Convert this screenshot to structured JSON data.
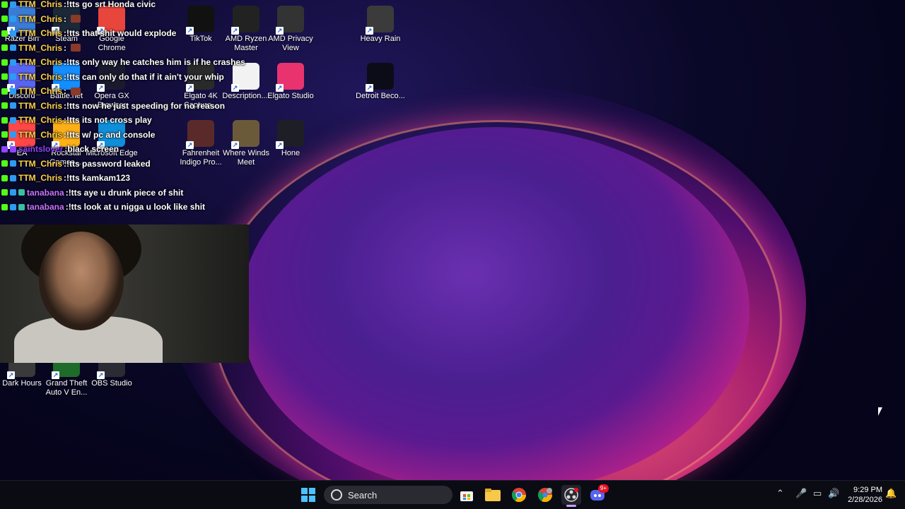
{
  "desktop_icons": [
    {
      "id": "razer",
      "label": "Razer Bin",
      "color": "#3a7bd5"
    },
    {
      "id": "steam",
      "label": "Steam",
      "color": "#1b2838"
    },
    {
      "id": "chrome",
      "label": "Google Chrome",
      "color": "#e8453c"
    },
    {
      "id": "tiktok",
      "label": "TikTok",
      "color": "#111111"
    },
    {
      "id": "ryzen",
      "label": "AMD Ryzen Master",
      "color": "#222222"
    },
    {
      "id": "amdprivacy",
      "label": "AMD Privacy View",
      "color": "#333333"
    },
    {
      "id": "heavyrain",
      "label": "Heavy Rain",
      "color": "#3b3b3b"
    },
    {
      "id": "discord",
      "label": "Discord",
      "color": "#5865f2"
    },
    {
      "id": "battlenet",
      "label": "Battle.net",
      "color": "#148eff"
    },
    {
      "id": "operagx",
      "label": "Opera GX Browser",
      "color": "#1a1a2e"
    },
    {
      "id": "elgato4k",
      "label": "Elgato 4K Capture...",
      "color": "#2a2a2a"
    },
    {
      "id": "description",
      "label": "Description....",
      "color": "#f2f2f2"
    },
    {
      "id": "elgatostudio",
      "label": "Elgato Studio",
      "color": "#e8336e"
    },
    {
      "id": "detroit",
      "label": "Detroit Beco...",
      "color": "#0c0c18"
    },
    {
      "id": "ea",
      "label": "EA",
      "color": "#ff4747"
    },
    {
      "id": "rockstar",
      "label": "Rockstar Games ...",
      "color": "#fcaf17"
    },
    {
      "id": "edge",
      "label": "Microsoft Edge",
      "color": "#0f8fd9"
    },
    {
      "id": "fahrenheit",
      "label": "Fahrenheit Indigo Pro...",
      "color": "#5a2a2a"
    },
    {
      "id": "wherewinds",
      "label": "Where Winds Meet",
      "color": "#6a5a3a"
    },
    {
      "id": "hone",
      "label": "Hone",
      "color": "#1e1e26"
    },
    {
      "id": "darkhours",
      "label": "Dark Hours",
      "color": "#3a3a3a"
    },
    {
      "id": "gta",
      "label": "Grand Theft Auto V En...",
      "color": "#1f6b2a"
    },
    {
      "id": "obs",
      "label": "OBS Studio",
      "color": "#2b2b33"
    }
  ],
  "chat": [
    {
      "user": "TTM_Chris",
      "user_color": "#ffd24a",
      "msg": "!tts go srt Honda civic",
      "badges": [
        "k",
        "b"
      ],
      "emote": false
    },
    {
      "user": "TTM_Chris",
      "user_color": "#ffd24a",
      "msg": "",
      "badges": [
        "k",
        "b"
      ],
      "emote": true
    },
    {
      "user": "TTM_Chris",
      "user_color": "#ffd24a",
      "msg": "!tts that shit would explode",
      "badges": [
        "k",
        "b"
      ],
      "emote": false
    },
    {
      "user": "TTM_Chris",
      "user_color": "#ffd24a",
      "msg": "",
      "badges": [
        "k",
        "b"
      ],
      "emote": true
    },
    {
      "user": "TTM_Chris",
      "user_color": "#ffd24a",
      "msg": "!tts only way he catches him is if he crashes",
      "badges": [
        "k",
        "b"
      ],
      "emote": false
    },
    {
      "user": "TTM_Chris",
      "user_color": "#ffd24a",
      "msg": "!tts can only do that if it ain't your whip",
      "badges": [
        "k",
        "b"
      ],
      "emote": false
    },
    {
      "user": "TTM_Chris",
      "user_color": "#ffd24a",
      "msg": "",
      "badges": [
        "k",
        "b"
      ],
      "emote": true
    },
    {
      "user": "TTM_Chris",
      "user_color": "#ffd24a",
      "msg": "!tts now he just speeding for no reason",
      "badges": [
        "k",
        "b"
      ],
      "emote": false
    },
    {
      "user": "TTM_Chris",
      "user_color": "#ffd24a",
      "msg": "!tts its not cross play",
      "badges": [
        "k",
        "b"
      ],
      "emote": false
    },
    {
      "user": "TTM_Chris",
      "user_color": "#ffd24a",
      "msg": "!tts w/ pc and console",
      "badges": [
        "k",
        "b"
      ],
      "emote": false
    },
    {
      "user": "saintslover",
      "user_color": "#9146ff",
      "msg": "black screen",
      "badges": [
        "p",
        "p"
      ],
      "emote": false
    },
    {
      "user": "TTM_Chris",
      "user_color": "#ffd24a",
      "msg": "!tts password leaked",
      "badges": [
        "k",
        "b"
      ],
      "emote": false
    },
    {
      "user": "TTM_Chris",
      "user_color": "#ffd24a",
      "msg": "!tts kamkam123",
      "badges": [
        "k",
        "b"
      ],
      "emote": false
    },
    {
      "user": "tanabana",
      "user_color": "#c873ff",
      "msg": "!tts aye u drunk piece of shit",
      "badges": [
        "k",
        "b",
        "g"
      ],
      "emote": false
    },
    {
      "user": "tanabana",
      "user_color": "#c873ff",
      "msg": "!tts look at u nigga u look like shit",
      "badges": [
        "k",
        "b",
        "g"
      ],
      "emote": false
    }
  ],
  "taskbar": {
    "search_placeholder": "Search",
    "apps": [
      "start-icon",
      "microsoft-store-icon",
      "file-explorer-icon",
      "chrome-icon",
      "chrome-profile-icon",
      "obs-icon",
      "discord-icon"
    ],
    "discord_badge": "9+",
    "time": "9:29 PM",
    "date": "2/28/2026"
  }
}
